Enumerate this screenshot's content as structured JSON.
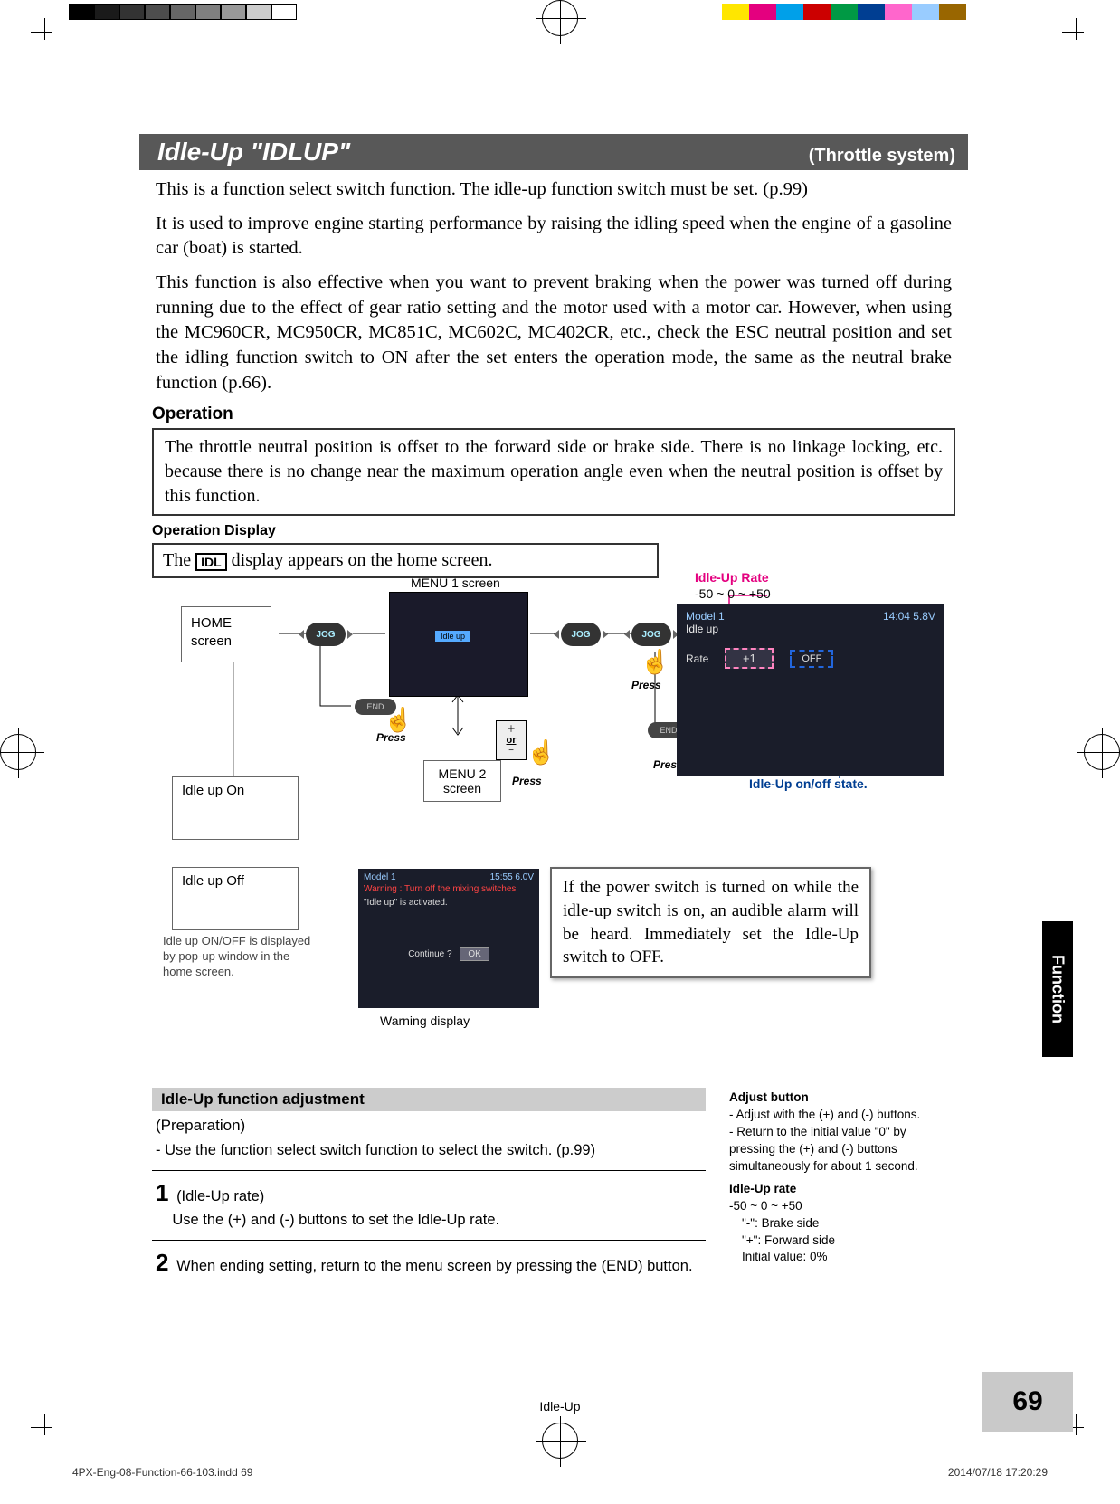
{
  "header": {
    "title": "Idle-Up \"IDLUP\"",
    "subtitle": "(Throttle system)"
  },
  "paragraphs": {
    "p1": "This is a function select switch function. The idle-up function switch must be set. (p.99)",
    "p2": "It is used to improve engine starting performance by raising the idling speed when the engine of a gasoline car (boat) is started.",
    "p3": "This function is also effective when you want to prevent braking when the power was turned off during running due to the effect of gear ratio setting and the motor used with a motor car. However, when using the MC960CR, MC950CR, MC851C, MC602C, MC402CR, etc., check the ESC neutral position and set the idling function switch to ON after the set enters the operation mode, the same as the neutral brake function (p.66)."
  },
  "operation": {
    "heading": "Operation",
    "box": "The throttle neutral position is offset to the forward side or brake side. There is no linkage locking, etc. because there is no change near the maximum operation angle even when the neutral position is offset by this function."
  },
  "display": {
    "heading": "Operation Display",
    "topline_pre": "The",
    "topline_badge": "IDL",
    "topline_post": "display appears on the home screen.",
    "home_box": "HOME screen",
    "menu1_label": "MENU 1 screen",
    "menu2_label": "MENU 2 screen",
    "menu1_highlight": "Idle up",
    "jog": "JOG",
    "end": "END",
    "press": "Press",
    "plus": "＋",
    "or": "or",
    "minus": "−",
    "idle_on": "Idle up On",
    "idle_off": "Idle up Off",
    "caption_onoff": "Idle up ON/OFF is displayed by pop-up window in the home screen.",
    "rate_label": "Idle-Up Rate",
    "rate_range": "-50 ~ 0 ~ +50",
    "idle_screen": {
      "model": "Model 1",
      "time": "14:04 5.8V",
      "name": "Idle up",
      "rate_lbl": "Rate",
      "rate_val": "+1",
      "off": "OFF"
    },
    "onoff_label": "Idle-Up on/off state.",
    "warn_screen": {
      "model": "Model 1",
      "time": "15:55 6.0V",
      "warning": "Warning : Turn off the mixing switches",
      "body": "\"Idle up\" is activated.",
      "continue": "Continue ?",
      "ok": "OK"
    },
    "warn_caption": "Warning display",
    "warn_box": "If the power switch is turned on while the idle-up switch is on, an audible alarm will be heard. Immediately set the Idle-Up switch to OFF."
  },
  "adjustment": {
    "title": "Idle-Up function adjustment",
    "prep": "(Preparation)",
    "prep_line": "- Use the function select switch function to select the switch. (p.99)",
    "step1_num": "1",
    "step1_title": "(Idle-Up rate)",
    "step1_body": "Use the (+) and (-) buttons to set the Idle-Up rate.",
    "step2_num": "2",
    "step2_body": "When ending setting, return to the menu screen by pressing the (END) button.",
    "side": {
      "adj_h": "Adjust button",
      "adj_l1": "- Adjust with the (+) and (-) buttons.",
      "adj_l2": "- Return to the initial value \"0\" by pressing the (+) and (-) buttons simultaneously for about 1 second.",
      "rate_h": "Idle-Up rate",
      "rate_range": "-50 ~ 0 ~ +50",
      "minus": "\"-\": Brake side",
      "plus": "\"+\": Forward side",
      "init": "Initial value: 0%"
    }
  },
  "footer": {
    "title": "Idle-Up",
    "page": "69",
    "side_tab": "Function",
    "print_left": "4PX-Eng-08-Function-66-103.indd   69",
    "print_right": "2014/07/18   17:20:29"
  },
  "colors": {
    "bw": [
      "#000",
      "#1a1a1a",
      "#333",
      "#4d4d4d",
      "#666",
      "#808080",
      "#999",
      "#ccc",
      "#fff"
    ],
    "chroma": [
      "#ffe600",
      "#e4007f",
      "#00a0e9",
      "#c00",
      "#009944",
      "#003e92",
      "#f6c",
      "#4cf",
      "#a60"
    ]
  }
}
